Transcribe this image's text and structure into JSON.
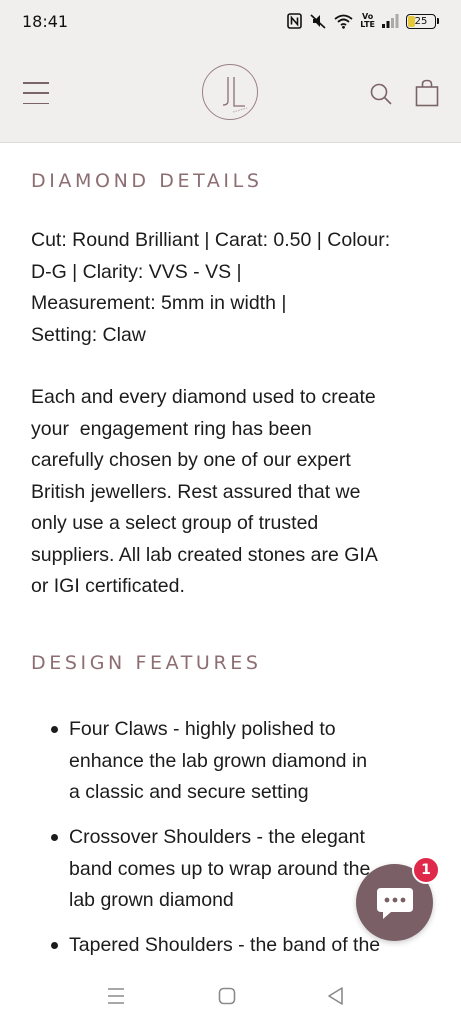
{
  "status_bar": {
    "time": "18:41",
    "battery_level": "25",
    "volte_top": "Vo",
    "volte_bottom": "LTE",
    "icons": [
      "nfc-icon",
      "mute-icon",
      "wifi-icon",
      "volte-icon",
      "signal-icon",
      "battery-icon"
    ]
  },
  "header": {
    "logo_letters": "JL",
    "icons": [
      "hamburger-menu-icon",
      "search-icon",
      "shopping-bag-icon"
    ]
  },
  "diamond_details": {
    "title": "DIAMOND DETAILS",
    "specs_lines": [
      "Cut: Round Brilliant | Carat: 0.50 | Colour:",
      "D-G | Clarity: VVS - VS |",
      "Measurement: 5mm in width |",
      "Setting: Claw"
    ],
    "description_lines": [
      "Each and every diamond used to create",
      "your  engagement ring has been",
      "carefully chosen by one of our expert",
      "British jewellers. Rest assured that we",
      "only use a select group of trusted",
      "suppliers. All lab created stones are GIA",
      "or IGI certificated."
    ]
  },
  "design_features": {
    "title": "DESIGN FEATURES",
    "items": [
      {
        "lines": [
          "Four Claws - highly polished to",
          "enhance the lab grown diamond in",
          "a classic and secure setting"
        ]
      },
      {
        "lines": [
          "Crossover Shoulders - the elegant",
          "band comes up to wrap around the",
          "lab grown diamond"
        ]
      },
      {
        "lines": [
          "Tapered Shoulders - the band of the"
        ]
      }
    ]
  },
  "chat": {
    "badge_count": "1",
    "icon": "chat-bubble-icon"
  },
  "nav_bar": {
    "icons": [
      "recents-icon",
      "home-icon",
      "back-icon"
    ]
  },
  "colors": {
    "accent": "#8c6e73",
    "header_bg": "#f1efed",
    "chat_bg": "#7a6066",
    "badge": "#e0284a"
  }
}
